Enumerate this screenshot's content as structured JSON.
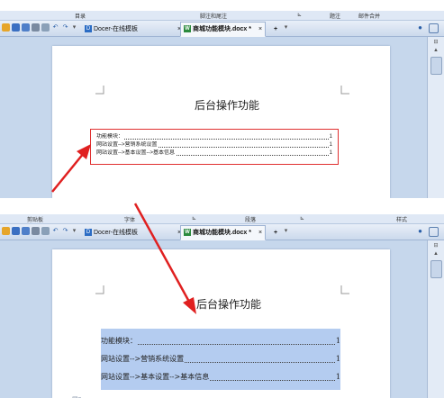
{
  "top_view": {
    "ribbon_groups": [
      "目录",
      "脚注和尾注",
      "题注",
      "邮件合并"
    ],
    "tabs": [
      {
        "label": "Docer-在线模板",
        "close": "×"
      },
      {
        "label": "商城功能模块.docx *",
        "close": "×"
      }
    ],
    "new_tab": "+",
    "doc_title": "后台操作功能",
    "toc": [
      {
        "text": "功能模块：",
        "page": "1"
      },
      {
        "text": "网站设置-->营销系统设置",
        "page": "1"
      },
      {
        "text": "网站设置-->基本设置-->基本信息",
        "page": "1"
      }
    ]
  },
  "bottom_view": {
    "ribbon_groups": [
      "剪贴板",
      "字体",
      "段落",
      "样式"
    ],
    "tabs": [
      {
        "label": "Docer-在线模板",
        "close": "×"
      },
      {
        "label": "商城功能模块.docx *",
        "close": "×"
      }
    ],
    "new_tab": "+",
    "doc_title": "后台操作功能",
    "toc": [
      {
        "text": "功能模块：",
        "page": "1"
      },
      {
        "text": "网站设置-->营销系统设置",
        "page": "1"
      },
      {
        "text": "网站设置-->基本设置-->基本信息",
        "page": "1"
      }
    ]
  },
  "colors": {
    "annotation": "#e02020",
    "selection": "#b4ccf0",
    "tab_icon": "#2b6cc4"
  }
}
